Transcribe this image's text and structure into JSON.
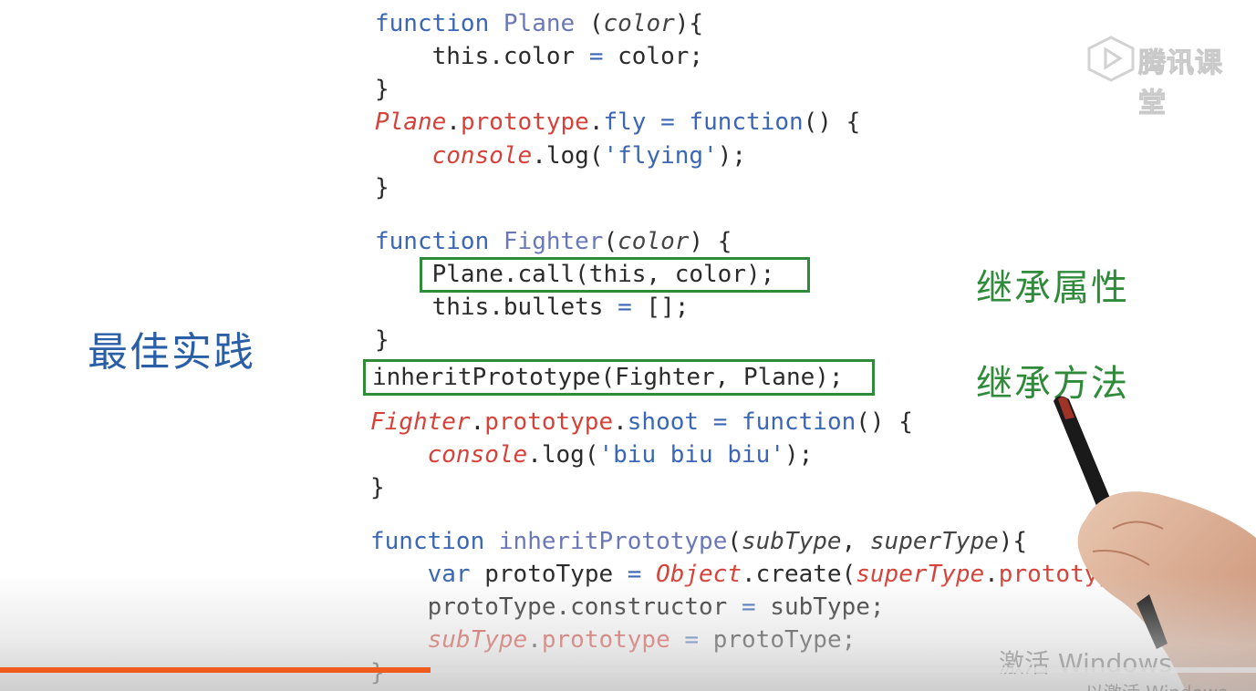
{
  "side_title": "最佳实践",
  "notes": {
    "inherit_props": "继承属性",
    "inherit_methods": "继承方法"
  },
  "logo": {
    "text": "腾讯课堂",
    "icon": "tencent-classroom-play-icon"
  },
  "video": {
    "progress": 0.343
  },
  "watermark": {
    "line1": "激活 Windows",
    "line2": "以激活 Windows"
  },
  "code": {
    "l01": [
      [
        "kw",
        "function"
      ],
      [
        "p",
        " "
      ],
      [
        "fn",
        "Plane"
      ],
      [
        "p",
        " ("
      ],
      [
        "param",
        "color"
      ],
      [
        "p",
        "){"
      ]
    ],
    "l02": [
      [
        "p",
        "    this.color "
      ],
      [
        "op",
        "="
      ],
      [
        "p",
        " color;"
      ]
    ],
    "l03": [
      [
        "p",
        "}"
      ]
    ],
    "l04": [
      [
        "cls",
        "Plane"
      ],
      [
        "p",
        "."
      ],
      [
        "prop",
        "prototype"
      ],
      [
        "p",
        "."
      ],
      [
        "method",
        "fly"
      ],
      [
        "p",
        " "
      ],
      [
        "op",
        "="
      ],
      [
        "p",
        " "
      ],
      [
        "kw",
        "function"
      ],
      [
        "p",
        "() {"
      ]
    ],
    "l05": [
      [
        "p",
        "    "
      ],
      [
        "cls",
        "console"
      ],
      [
        "p",
        ".log("
      ],
      [
        "str",
        "'flying'"
      ],
      [
        "p",
        ");"
      ]
    ],
    "l06": [
      [
        "p",
        "}"
      ]
    ],
    "l07": [
      [
        "kw",
        "function"
      ],
      [
        "p",
        " "
      ],
      [
        "fn",
        "Fighter"
      ],
      [
        "p",
        "("
      ],
      [
        "param",
        "color"
      ],
      [
        "p",
        ") {"
      ]
    ],
    "l08": [
      [
        "p",
        "    Plane.call(this, color);"
      ]
    ],
    "l09": [
      [
        "p",
        "    this.bullets "
      ],
      [
        "op",
        "="
      ],
      [
        "p",
        " [];"
      ]
    ],
    "l10": [
      [
        "p",
        "}"
      ]
    ],
    "l11": [
      [
        "p",
        "inheritPrototype(Fighter, Plane);"
      ]
    ],
    "l12": [
      [
        "cls",
        "Fighter"
      ],
      [
        "p",
        "."
      ],
      [
        "prop",
        "prototype"
      ],
      [
        "p",
        "."
      ],
      [
        "method",
        "shoot"
      ],
      [
        "p",
        " "
      ],
      [
        "op",
        "="
      ],
      [
        "p",
        " "
      ],
      [
        "kw",
        "function"
      ],
      [
        "p",
        "() {"
      ]
    ],
    "l13": [
      [
        "p",
        "    "
      ],
      [
        "cls",
        "console"
      ],
      [
        "p",
        ".log("
      ],
      [
        "str",
        "'biu biu biu'"
      ],
      [
        "p",
        ");"
      ]
    ],
    "l14": [
      [
        "p",
        "}"
      ]
    ],
    "l15": [
      [
        "kw",
        "function"
      ],
      [
        "p",
        " "
      ],
      [
        "fn",
        "inheritPrototype"
      ],
      [
        "p",
        "("
      ],
      [
        "param",
        "subType"
      ],
      [
        "p",
        ", "
      ],
      [
        "param",
        "superType"
      ],
      [
        "p",
        "){"
      ]
    ],
    "l16": [
      [
        "p",
        "    "
      ],
      [
        "kw",
        "var"
      ],
      [
        "p",
        " protoType "
      ],
      [
        "op",
        "="
      ],
      [
        "p",
        " "
      ],
      [
        "cls",
        "Object"
      ],
      [
        "p",
        ".create("
      ],
      [
        "cls",
        "superType"
      ],
      [
        "p",
        "."
      ],
      [
        "prop",
        "prototype"
      ],
      [
        "p",
        ");"
      ]
    ],
    "l17": [
      [
        "p",
        "    protoType.constructor "
      ],
      [
        "op",
        "="
      ],
      [
        "p",
        " subType;"
      ]
    ],
    "l18": [
      [
        "p",
        "    "
      ],
      [
        "cls",
        "subType"
      ],
      [
        "p",
        "."
      ],
      [
        "prop",
        "prototype"
      ],
      [
        "p",
        " "
      ],
      [
        "op",
        "="
      ],
      [
        "p",
        " protoType;"
      ]
    ],
    "l19": [
      [
        "p",
        "}"
      ]
    ]
  },
  "colors": {
    "note_green": "#2f8a3a",
    "title_blue": "#2a5fa8",
    "progress_orange": "#f05a1a"
  }
}
